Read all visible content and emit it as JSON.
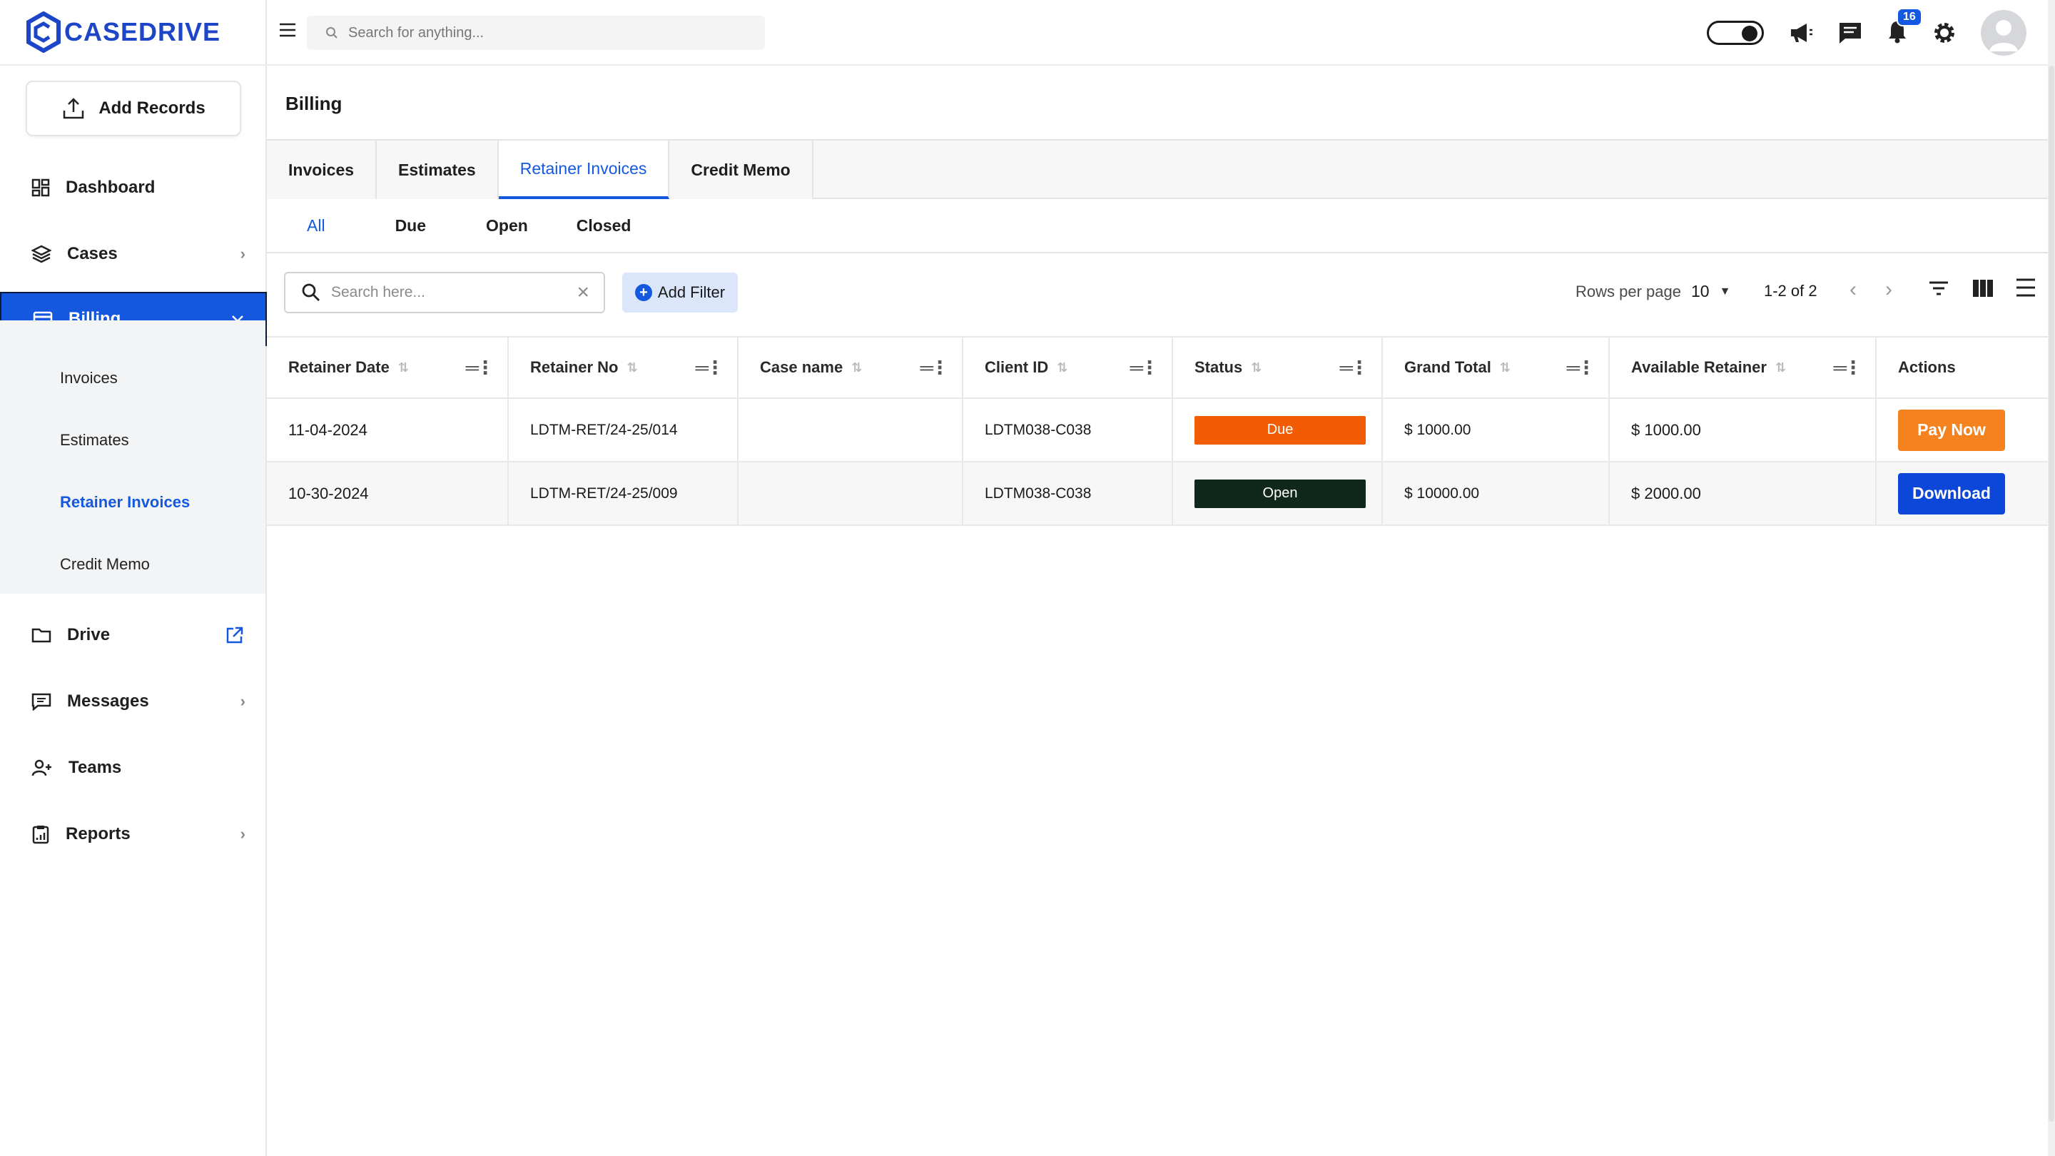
{
  "app": {
    "name": "CASEDRIVE",
    "brand_color": "#1458e0"
  },
  "sidebar": {
    "add_records": "Add Records",
    "items": [
      {
        "label": "Dashboard",
        "icon": "dashboard-icon"
      },
      {
        "label": "Cases",
        "icon": "layers-icon"
      },
      {
        "label": "Billing",
        "icon": "card-icon"
      },
      {
        "label": "Drive",
        "icon": "folder-icon"
      },
      {
        "label": "Messages",
        "icon": "message-icon"
      },
      {
        "label": "Teams",
        "icon": "team-icon"
      },
      {
        "label": "Reports",
        "icon": "clipboard-icon"
      }
    ],
    "billing_sub": [
      "Invoices",
      "Estimates",
      "Retainer Invoices",
      "Credit Memo"
    ]
  },
  "topbar": {
    "search_placeholder": "Search for anything...",
    "notification_count": "16"
  },
  "page": {
    "title": "Billing",
    "tabs": [
      "Invoices",
      "Estimates",
      "Retainer Invoices",
      "Credit Memo"
    ],
    "subtabs": [
      "All",
      "Due",
      "Open",
      "Closed"
    ],
    "table_search_placeholder": "Search here...",
    "add_filter": "Add Filter",
    "rows_per_page_label": "Rows per page",
    "rows_per_page_value": "10",
    "range": "1-2 of 2"
  },
  "table": {
    "columns": [
      "Retainer Date",
      "Retainer No",
      "Case name",
      "Client ID",
      "Status",
      "Grand Total",
      "Available Retainer",
      "Actions"
    ],
    "rows": [
      {
        "date": "11-04-2024",
        "no": "LDTM-RET/24-25/014",
        "case": "",
        "client": "LDTM038-C038",
        "status": "Due",
        "grand_total": "$ 1000.00",
        "available": "$ 1000.00",
        "action": "Pay Now"
      },
      {
        "date": "10-30-2024",
        "no": "LDTM-RET/24-25/009",
        "case": "",
        "client": "LDTM038-C038",
        "status": "Open",
        "grand_total": "$ 10000.00",
        "available": "$ 2000.00",
        "action": "Download"
      }
    ]
  }
}
